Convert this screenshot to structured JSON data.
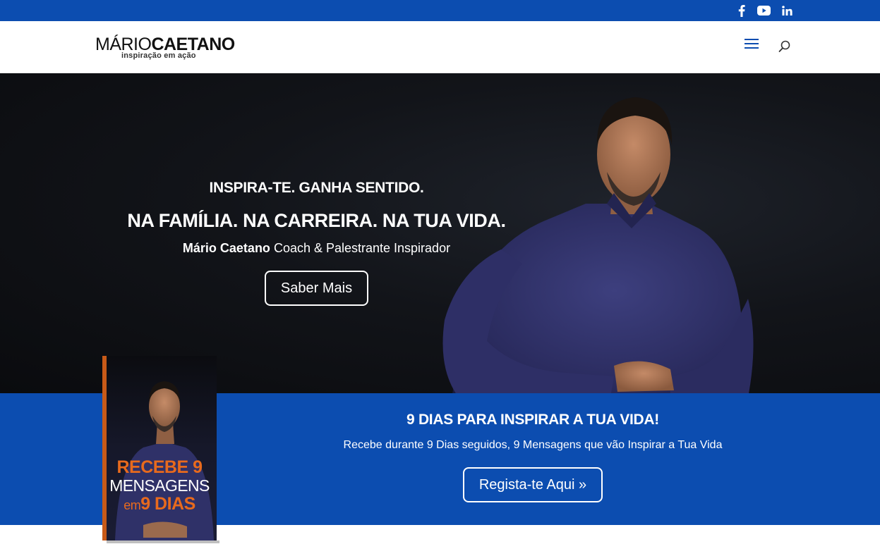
{
  "colors": {
    "brand_blue": "#0c4db0",
    "accent_orange": "#e86a1d",
    "hero_bg": "#111318"
  },
  "social": [
    {
      "name": "facebook-icon"
    },
    {
      "name": "youtube-icon"
    },
    {
      "name": "linkedin-icon"
    }
  ],
  "logo": {
    "name_light": "MÁRIO",
    "name_bold": "CAETANO",
    "tagline": "inspiração em ação"
  },
  "header": {
    "menu_icon": "hamburger-menu-icon",
    "search_icon": "search-icon"
  },
  "hero": {
    "line1": "INSPIRA-TE. GANHA SENTIDO.",
    "line2": "NA FAMÍLIA. NA CARREIRA. NA TUA VIDA.",
    "line3_name": "Mário Caetano",
    "line3_rest": " Coach & Palestrante Inspirador",
    "button": "Saber Mais"
  },
  "band": {
    "title": "9 DIAS PARA INSPIRAR A TUA VIDA!",
    "subtitle": "Recebe durante 9 Dias seguidos, 9 Mensagens que vão Inspirar a Tua Vida",
    "button": "Regista-te Aqui »"
  },
  "book": {
    "line1": "RECEBE 9",
    "line2": "MENSAGENS",
    "line3_small": "em",
    "line3_big": "9 DIAS"
  }
}
